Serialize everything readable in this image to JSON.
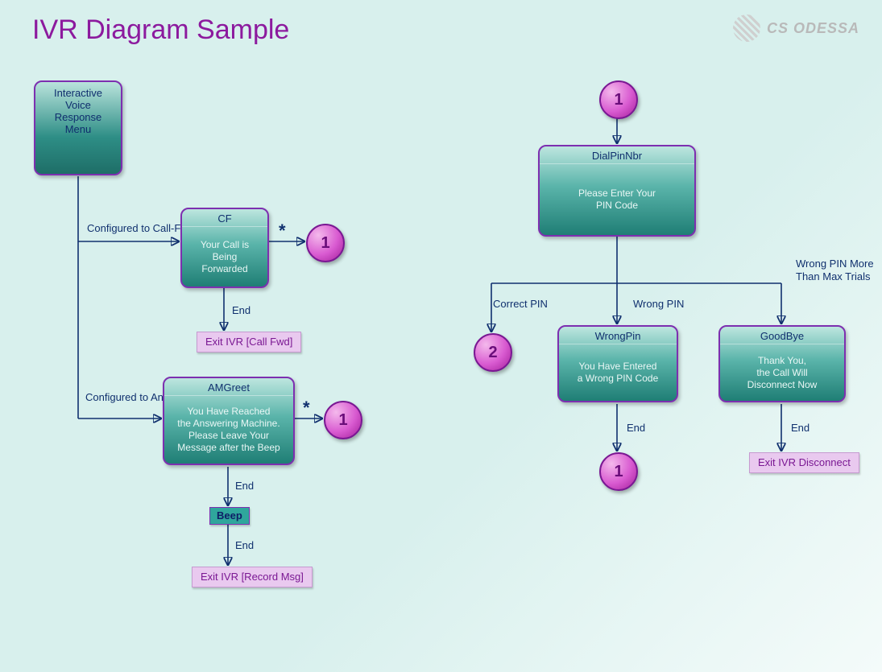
{
  "title": "IVR Diagram Sample",
  "logo": "CS ODESSA",
  "left": {
    "menu": "Interactive\nVoice\nResponse\nMenu",
    "branch1_label": "Configured\nto Call-Forward",
    "branch2_label": "Configured\nto Answering\nMachine",
    "cf": {
      "head": "CF",
      "body": "Your Call is\nBeing\nForwarded"
    },
    "cf_end": "End",
    "cf_exit": "Exit IVR\n[Call Fwd]",
    "cf_star": "*",
    "cf_circle": "1",
    "am": {
      "head": "AMGreet",
      "body": "You Have Reached\nthe Answering Machine.\nPlease Leave Your\nMessage after the Beep"
    },
    "am_star": "*",
    "am_circle": "1",
    "am_end1": "End",
    "beep": "Beep",
    "am_end2": "End",
    "am_exit": "Exit IVR\n[Record Msg]"
  },
  "right": {
    "top_circle": "1",
    "dial": {
      "head": "DialPinNbr",
      "body": "Please Enter Your\nPIN Code"
    },
    "b_correct": "Correct PIN",
    "b_wrong": "Wrong PIN",
    "b_max": "Wrong PIN\nMore Than\nMax Trials",
    "correct_circle": "2",
    "wrong": {
      "head": "WrongPin",
      "body": "You Have Entered\na Wrong PIN Code"
    },
    "wrong_end": "End",
    "wrong_circle": "1",
    "bye": {
      "head": "GoodBye",
      "body": "Thank You,\nthe Call Will\nDisconnect Now"
    },
    "bye_end": "End",
    "bye_exit": "Exit IVR\nDisconnect"
  }
}
